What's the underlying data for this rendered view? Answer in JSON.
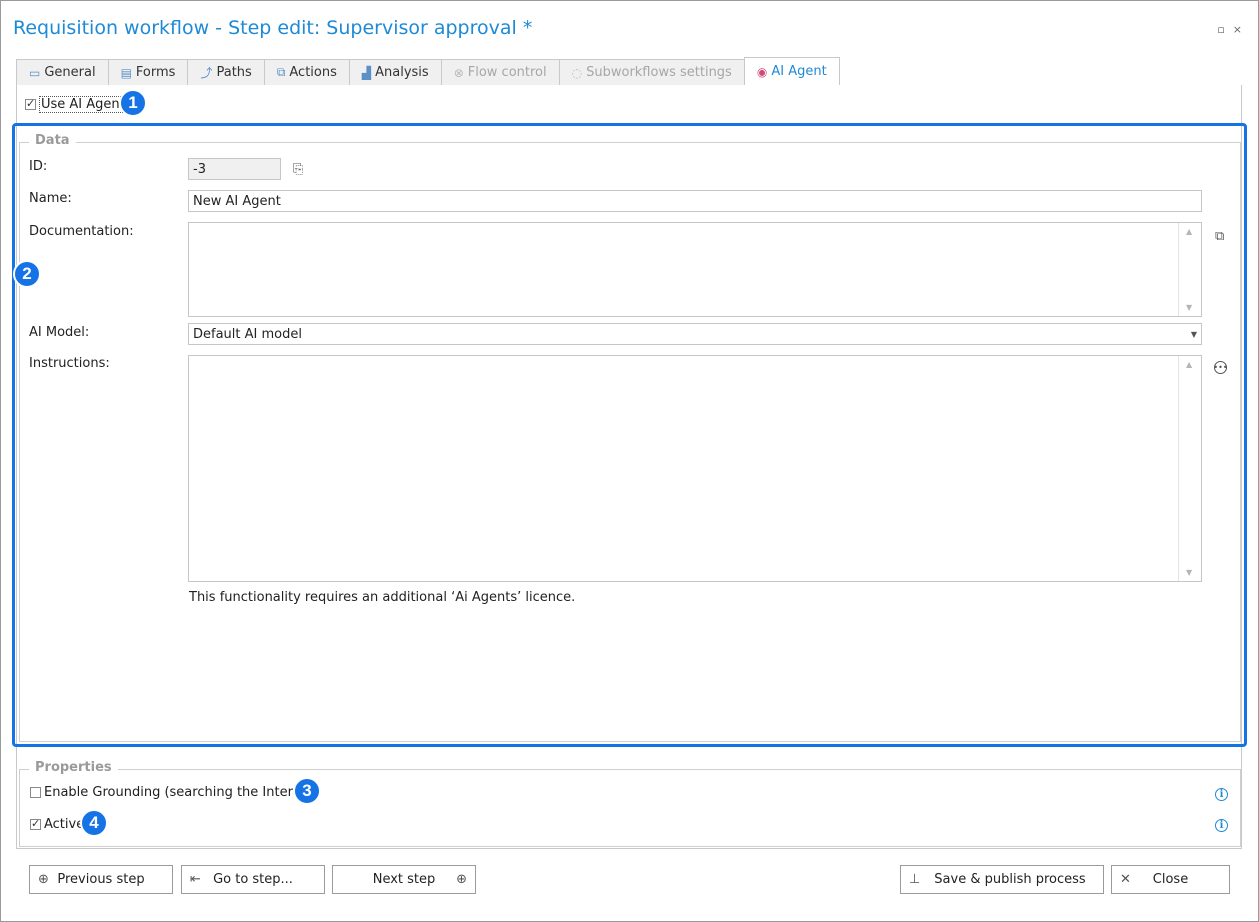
{
  "window": {
    "title": "Requisition workflow - Step edit: Supervisor approval *",
    "controls": {
      "restore": "▫",
      "close": "×"
    }
  },
  "tabs": [
    {
      "label": "General",
      "icon": "window-icon",
      "glyph": "▭",
      "state": "normal"
    },
    {
      "label": "Forms",
      "icon": "form-icon",
      "glyph": "▤",
      "state": "normal"
    },
    {
      "label": "Paths",
      "icon": "paths-icon",
      "glyph": "⤴",
      "state": "normal"
    },
    {
      "label": "Actions",
      "icon": "actions-icon",
      "glyph": "⧉",
      "state": "normal"
    },
    {
      "label": "Analysis",
      "icon": "analysis-icon",
      "glyph": "▟",
      "state": "normal"
    },
    {
      "label": "Flow control",
      "icon": "flow-control-icon",
      "glyph": "⊗",
      "state": "disabled"
    },
    {
      "label": "Subworkflows settings",
      "icon": "subworkflow-icon",
      "glyph": "◌",
      "state": "disabled"
    },
    {
      "label": "AI Agent",
      "icon": "ai-agent-icon",
      "glyph": "◉",
      "state": "active"
    }
  ],
  "use_ai_agent": {
    "label": "Use AI Agent",
    "checked": true
  },
  "badges": [
    "1",
    "2",
    "3",
    "4"
  ],
  "data_group": {
    "legend": "Data",
    "id": {
      "label": "ID:",
      "value": "-3"
    },
    "name": {
      "label": "Name:",
      "value": "New AI Agent"
    },
    "documentation": {
      "label": "Documentation:",
      "value": ""
    },
    "ai_model": {
      "label": "AI Model:",
      "value": "Default AI model"
    },
    "instructions": {
      "label": "Instructions:",
      "value": ""
    },
    "note": "This functionality requires an additional ‘Ai Agents’ licence."
  },
  "properties_group": {
    "legend": "Properties",
    "grounding": {
      "label": "Enable Grounding (searching the Internet)",
      "checked": false
    },
    "active": {
      "label": "Active",
      "checked": true
    }
  },
  "buttons": {
    "previous": "Previous step",
    "goto": "Go to step...",
    "next": "Next step",
    "save_publish": "Save & publish process",
    "close": "Close"
  },
  "colors": {
    "accent": "#1e8ad6",
    "highlight": "#1573e6"
  }
}
